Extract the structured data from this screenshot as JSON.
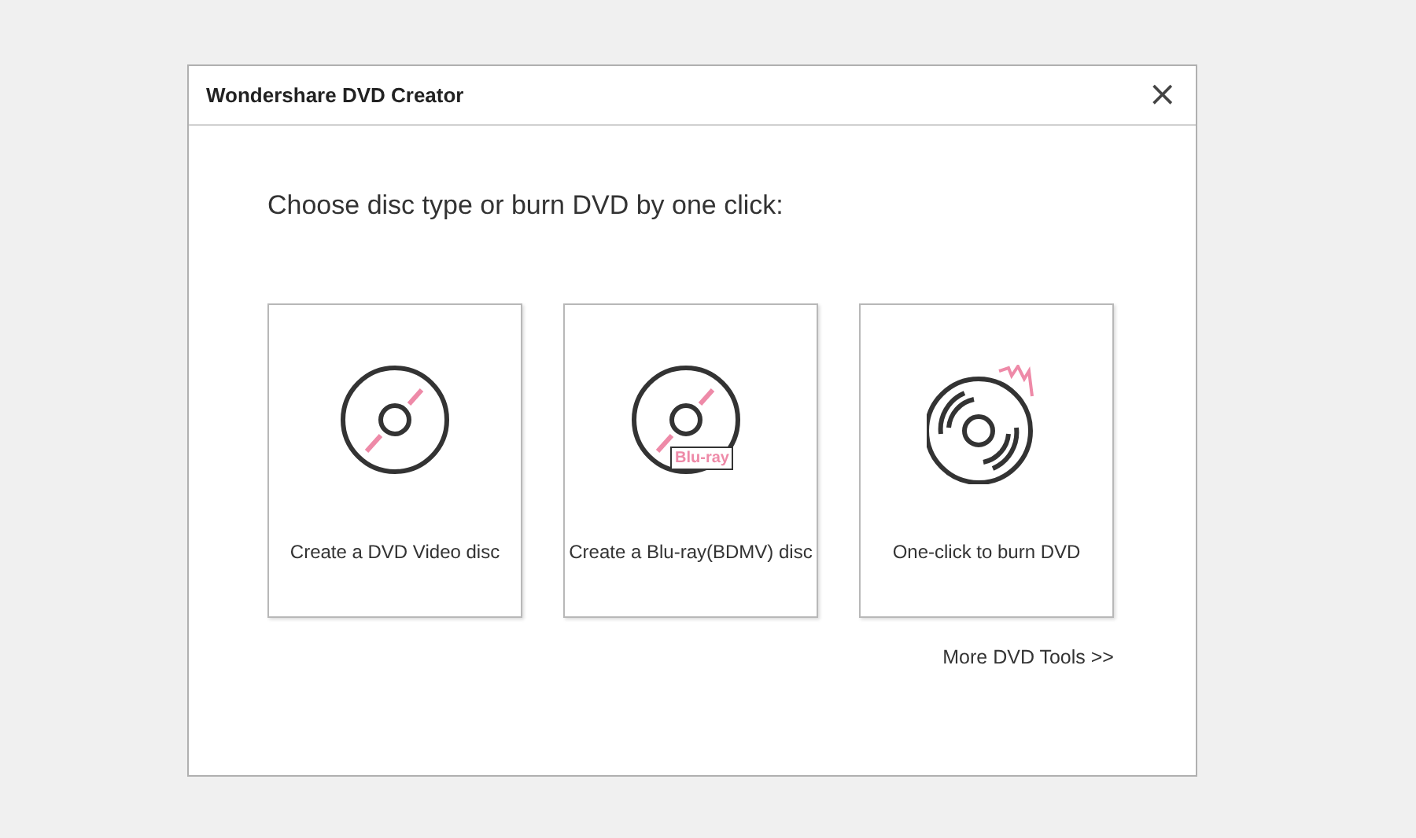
{
  "window": {
    "title": "Wondershare DVD Creator",
    "close": "×"
  },
  "heading": "Choose disc type or burn DVD by one click:",
  "options": [
    {
      "kind": "dvd",
      "label": "Create a DVD Video disc"
    },
    {
      "kind": "bluray",
      "label": "Create a Blu-ray(BDMV) disc",
      "badge": "Blu-ray"
    },
    {
      "kind": "burn",
      "label": "One-click to burn DVD"
    }
  ],
  "more_link": "More DVD Tools >>"
}
